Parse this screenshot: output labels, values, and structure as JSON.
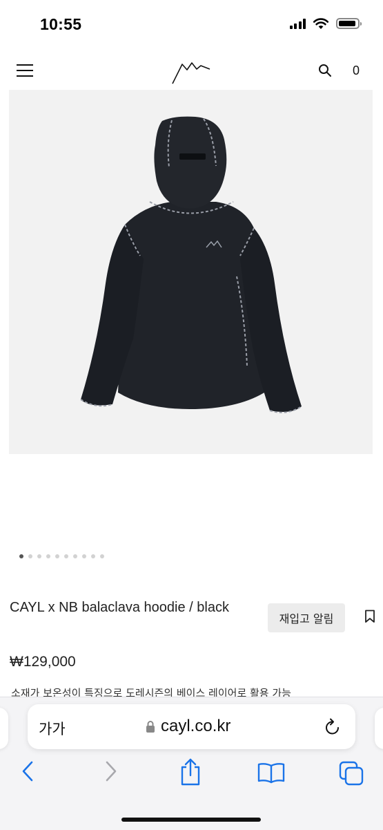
{
  "status_bar": {
    "time": "10:55",
    "battery_level": 0.9
  },
  "header": {
    "menu_icon": "hamburger-menu-icon",
    "logo_icon": "mountain-logo-icon",
    "search_icon": "search-icon",
    "cart_count": "0"
  },
  "product": {
    "image_icon": "hoodie-product-photo",
    "carousel": {
      "total": 10,
      "active_index": 0
    },
    "title": "CAYL x NB balaclava hoodie / black",
    "price": "₩129,000",
    "restock_label": "재입고 알림",
    "bookmark_icon": "bookmark-icon",
    "description_preview": "소재가 보온성이 특징으로 도레시즌의 베이스 레이어로 활용 가능"
  },
  "browser": {
    "text_size_label": "가가",
    "url": "cayl.co.kr",
    "lock_icon": "lock-icon",
    "reload_icon": "reload-icon",
    "toolbar": {
      "back_icon": "back-chevron-icon",
      "forward_icon": "forward-chevron-icon",
      "share_icon": "share-icon",
      "bookmarks_icon": "book-icon",
      "tabs_icon": "tabs-icon"
    }
  },
  "colors": {
    "accent": "#1a73e8",
    "disabled": "#a8a8ad",
    "text": "#222222",
    "image_bg": "#f2f2f2"
  }
}
